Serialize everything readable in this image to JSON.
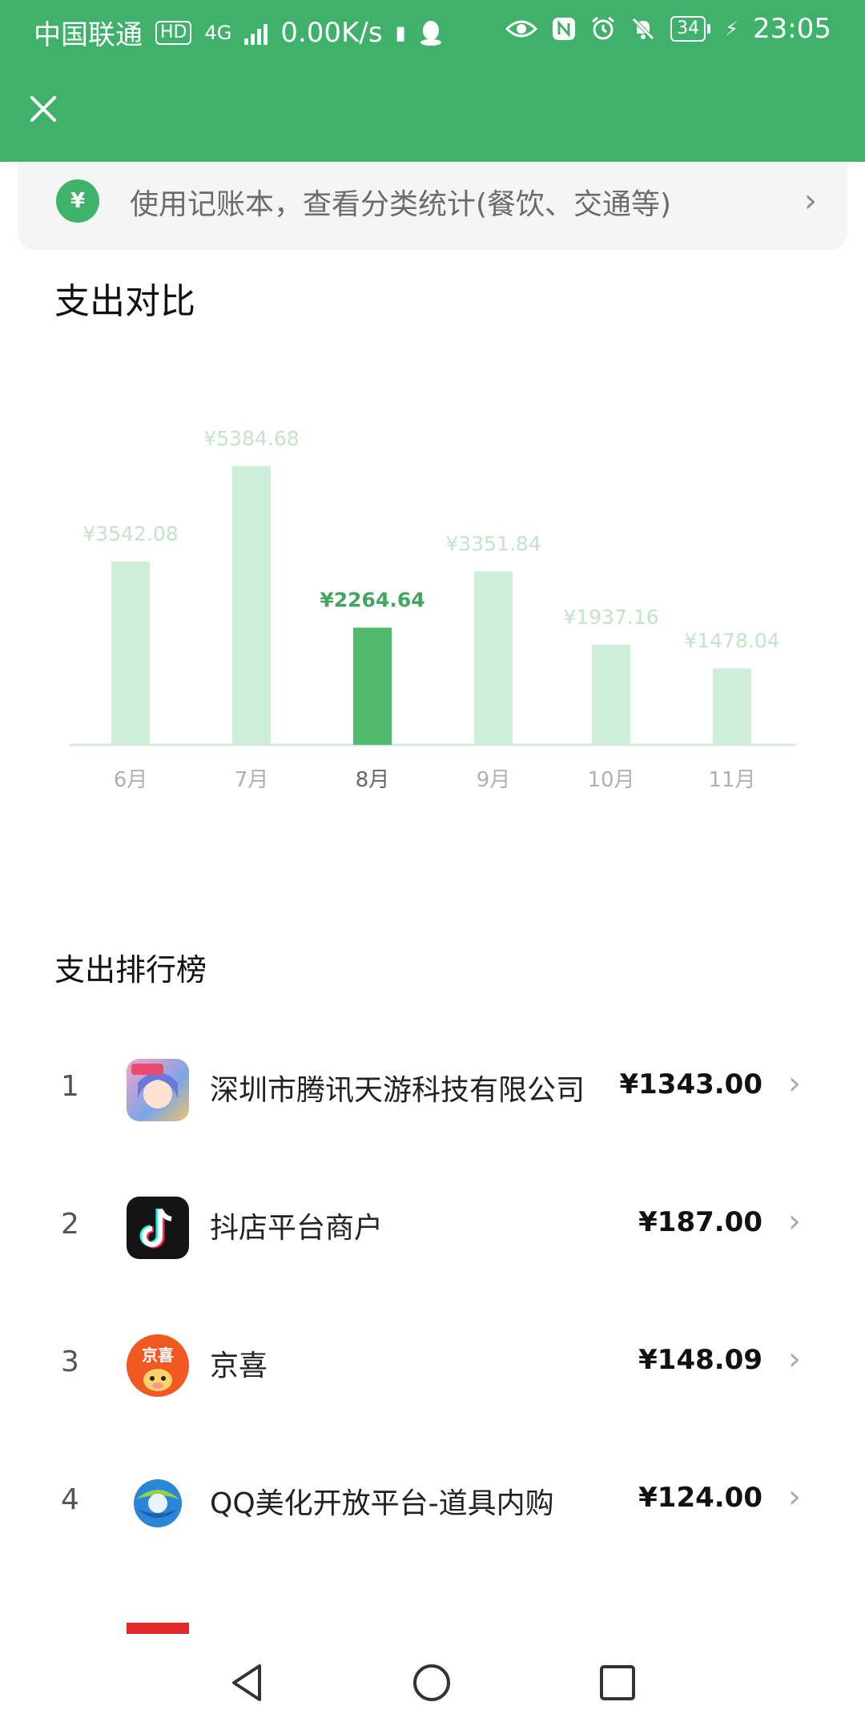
{
  "status_bar": {
    "carrier": "中国联通",
    "hd": "HD",
    "network": "4G",
    "speed": "0.00K/s",
    "battery": "34",
    "time": "23:05"
  },
  "header": {
    "close_icon": "close-icon",
    "color": "#40b16b"
  },
  "banner": {
    "icon_text": "¥",
    "text": "使用记账本，查看分类统计(餐饮、交通等)"
  },
  "chart_section": {
    "title": "支出对比"
  },
  "chart_data": {
    "type": "bar",
    "categories": [
      "6月",
      "7月",
      "8月",
      "9月",
      "10月",
      "11月"
    ],
    "values": [
      3542.08,
      5384.68,
      2264.64,
      3351.84,
      1937.16,
      1478.04
    ],
    "value_labels": [
      "¥3542.08",
      "¥5384.68",
      "¥2264.64",
      "¥3351.84",
      "¥1937.16",
      "¥1478.04"
    ],
    "highlight_index": 2,
    "colors": {
      "bar": "#cfeed9",
      "highlight": "#52ba6c",
      "label": "#c3e3cc",
      "highlight_label": "#43a561",
      "axis": "#d5ecdc",
      "tick": "#b0b0b0",
      "highlight_tick": "#666666"
    },
    "ylim": [
      0,
      5384.68
    ]
  },
  "ranking": {
    "title": "支出排行榜",
    "items": [
      {
        "rank": "1",
        "name": "深圳市腾讯天游科技有限公司",
        "amount": "¥1343.00",
        "icon": "game-app-icon"
      },
      {
        "rank": "2",
        "name": "抖店平台商户",
        "amount": "¥187.00",
        "icon": "tiktok-icon"
      },
      {
        "rank": "3",
        "name": "京喜",
        "amount": "¥148.09",
        "icon": "jingxi-icon",
        "icon_text": "京喜"
      },
      {
        "rank": "4",
        "name": "QQ美化开放平台-道具内购",
        "amount": "¥124.00",
        "icon": "qq-beautify-icon"
      }
    ]
  },
  "navbar": {
    "back": "back-icon",
    "home": "home-icon",
    "recent": "recent-apps-icon"
  }
}
